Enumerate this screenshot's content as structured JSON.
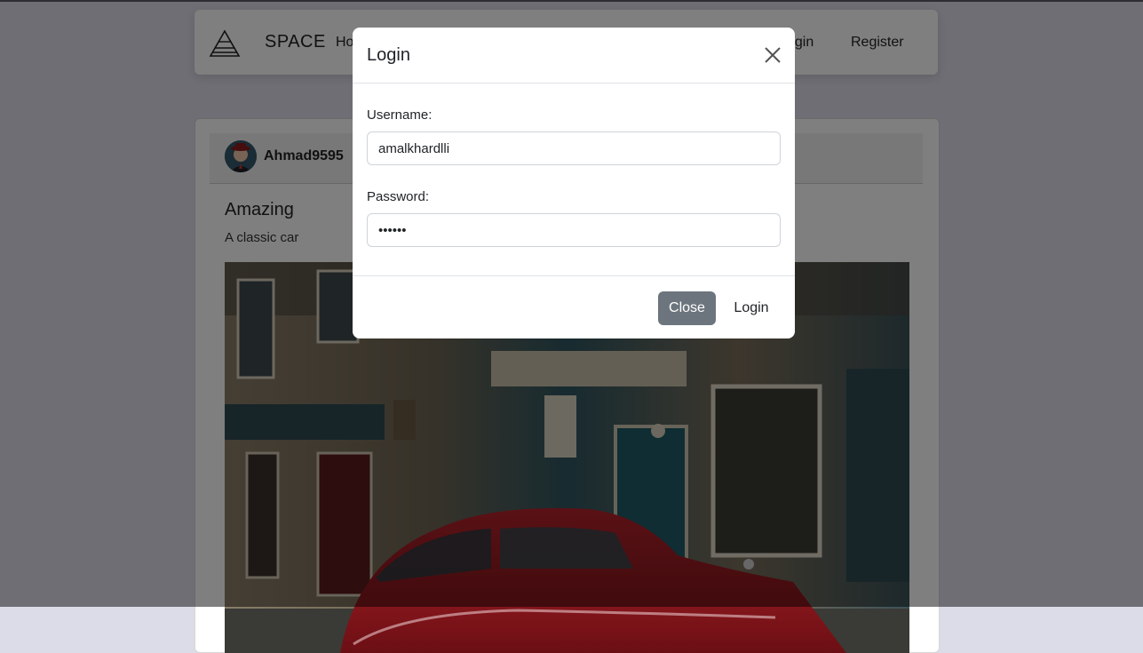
{
  "navbar": {
    "brand": "SPACE",
    "links": {
      "home": "Ho",
      "login": "ogin",
      "register": "Register"
    }
  },
  "post": {
    "author": "Ahmad9595",
    "title": "Amazing",
    "description": "A classic car"
  },
  "modal": {
    "title": "Login",
    "username_label": "Username:",
    "username_value": "amalkhardlli",
    "password_label": "Password:",
    "password_value": "••••••",
    "close_button": "Close",
    "login_button": "Login"
  },
  "colors": {
    "secondary_button": "#6c757d",
    "backdrop": "rgba(0,0,0,0.5)"
  },
  "icons": [
    "pyramid-logo-icon",
    "close-icon"
  ]
}
